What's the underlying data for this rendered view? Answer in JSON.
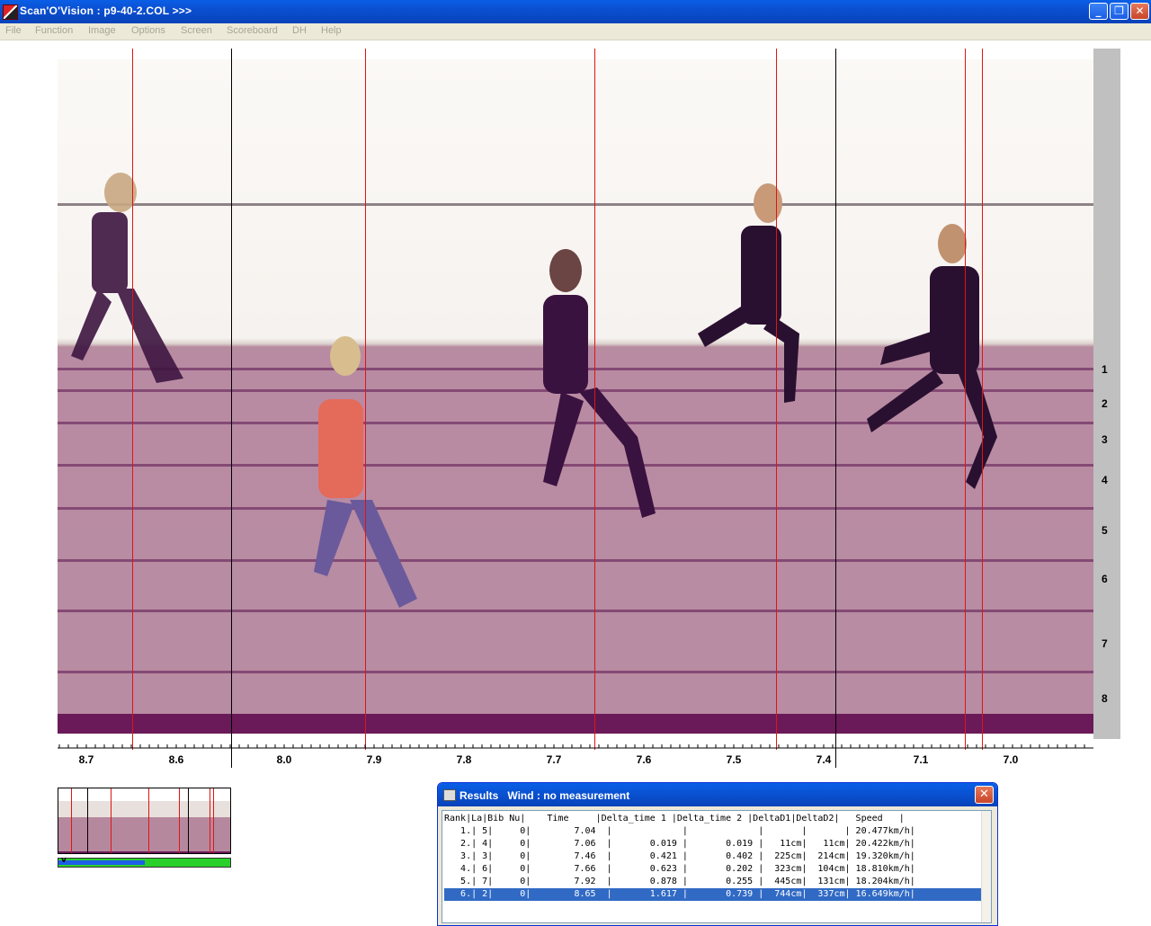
{
  "window": {
    "title": "Scan'O'Vision :  p9-40-2.COL  >>>",
    "min_glyph": "_",
    "max_glyph": "❐",
    "close_glyph": "✕"
  },
  "menu": [
    "File",
    "Function",
    "Image",
    "Options",
    "Screen",
    "Scoreboard",
    "DH",
    "Help"
  ],
  "lanes": [
    "1",
    "2",
    "3",
    "4",
    "5",
    "6",
    "7",
    "8"
  ],
  "time_axis": {
    "labels": [
      "8.7",
      "8.6",
      "8.0",
      "7.9",
      "7.8",
      "7.7",
      "7.6",
      "7.5",
      "7.4",
      "7.1",
      "7.0"
    ]
  },
  "results": {
    "title": "Results   Wind : no measurement",
    "close_glyph": "✕",
    "header": "Rank|La|Bib Nu|    Time     |Delta_time 1 |Delta_time 2 |DeltaD1|DeltaD2|   Speed   |",
    "rows": [
      "   1.| 5|     0|        7.04  |             |             |       |       | 20.477km/h|",
      "   2.| 4|     0|        7.06  |       0.019 |       0.019 |   11cm|   11cm| 20.422km/h|",
      "   3.| 3|     0|        7.46  |       0.421 |       0.402 |  225cm|  214cm| 19.320km/h|",
      "   4.| 6|     0|        7.66  |       0.623 |       0.202 |  323cm|  104cm| 18.810km/h|",
      "   5.| 7|     0|        7.92  |       0.878 |       0.255 |  445cm|  131cm| 18.204km/h|",
      "   6.| 2|     0|        8.65  |       1.617 |       0.739 |  744cm|  337cm| 16.649km/h|"
    ],
    "selected_row": 5
  },
  "thumbnail": {
    "progress": 0.5,
    "marker": "v"
  },
  "colors": {
    "marker_red": "#e01414",
    "track_pink": "#b98ba3",
    "title_blue": "#0b4fd1"
  }
}
